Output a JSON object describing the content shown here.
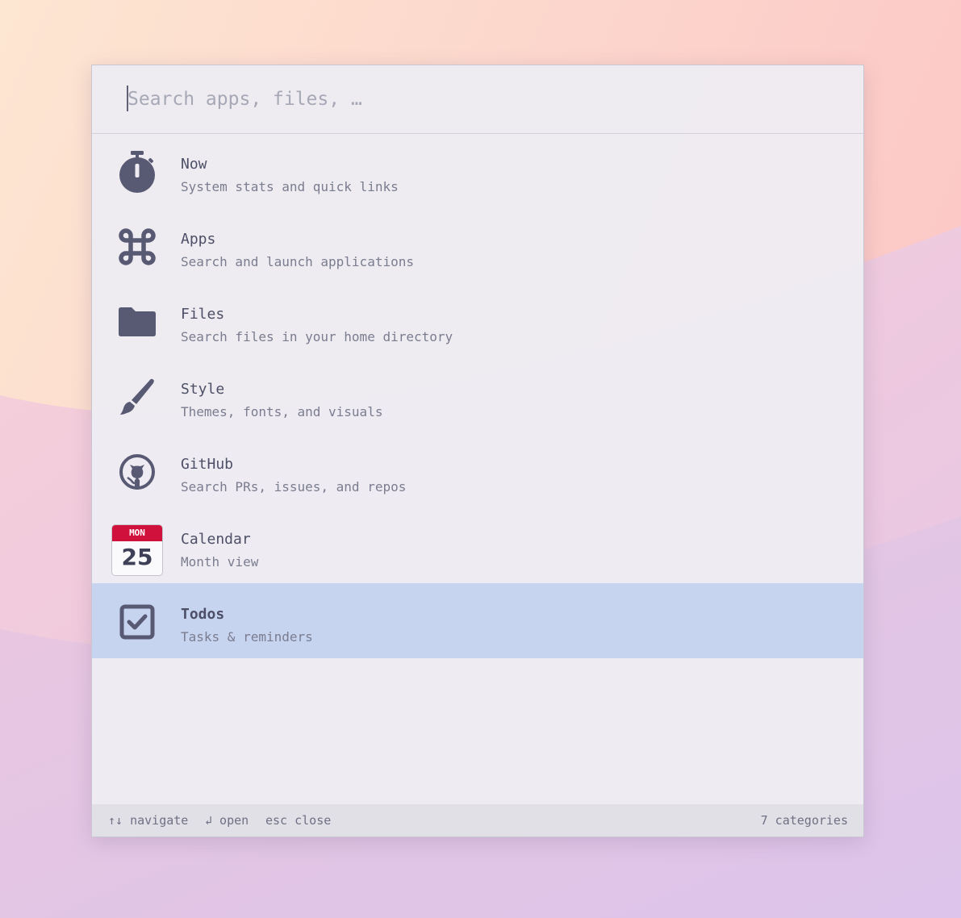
{
  "search": {
    "placeholder": "Search apps, files, …",
    "value": ""
  },
  "items": [
    {
      "title": "Now",
      "subtitle": "System stats and quick links",
      "icon": "stopwatch-icon"
    },
    {
      "title": "Apps",
      "subtitle": "Search and launch applications",
      "icon": "command-icon"
    },
    {
      "title": "Files",
      "subtitle": "Search files in your home directory",
      "icon": "folder-icon"
    },
    {
      "title": "Style",
      "subtitle": "Themes, fonts, and visuals",
      "icon": "paintbrush-icon"
    },
    {
      "title": "GitHub",
      "subtitle": "Search PRs, issues, and repos",
      "icon": "github-icon"
    },
    {
      "title": "Calendar",
      "subtitle": "Month view",
      "icon": "calendar-icon",
      "calendar": {
        "weekday": "MON",
        "day": "25"
      }
    },
    {
      "title": "Todos",
      "subtitle": "Tasks & reminders",
      "icon": "checkbox-icon",
      "selected": true
    }
  ],
  "footer": {
    "navigate": "↑↓ navigate",
    "open": "↲ open",
    "close": "esc close",
    "count": "7 categories"
  },
  "colors": {
    "icon": "#585a74",
    "selected_bg": "#c7d4f0",
    "calendar_red": "#d0113c"
  }
}
